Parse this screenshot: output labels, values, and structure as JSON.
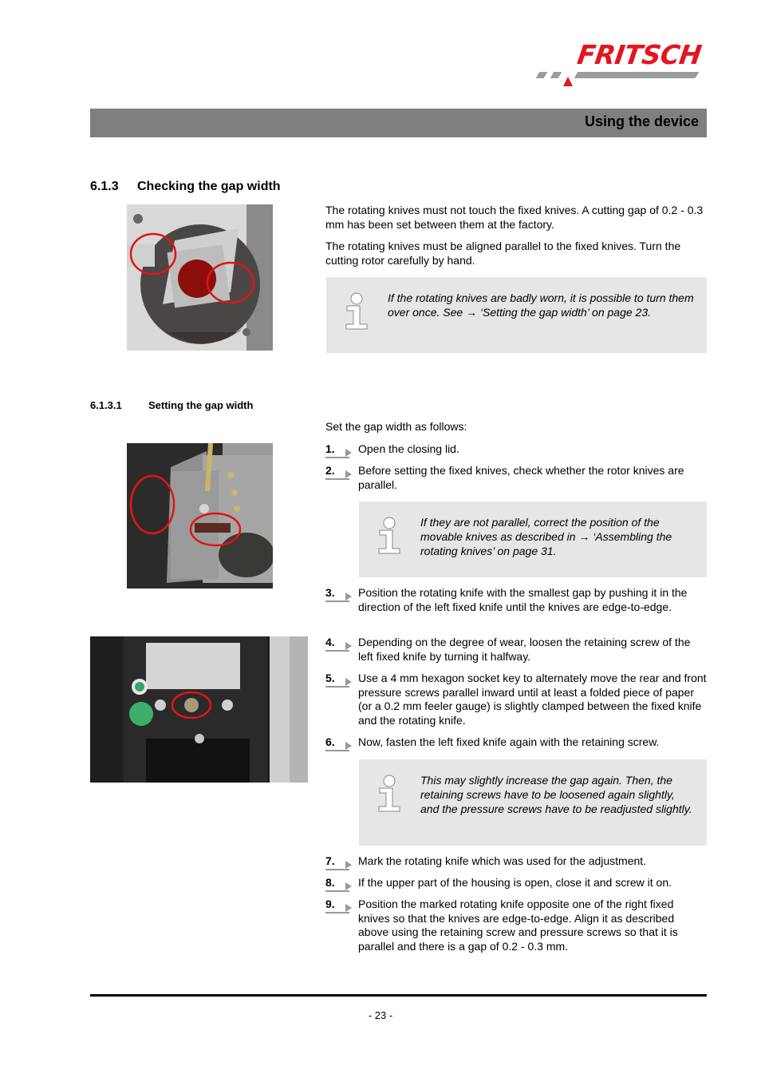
{
  "brand": {
    "logo_text": "FRITSCH",
    "accent": "#e3151e",
    "bar_gray": "#9c9c9c"
  },
  "header": {
    "title": "Using the device",
    "band_color": "#7f7f7f"
  },
  "section": {
    "number": "6.1.3",
    "title": "Checking the gap width",
    "paragraphs": [
      "The rotating knives must not touch the fixed knives. A cutting gap of 0.2 - 0.3 mm has been set between them at the factory.",
      "The rotating knives must be aligned parallel to the fixed knives. Turn the cutting rotor carefully by hand."
    ],
    "info": "If the rotating knives are badly worn, it is possible to turn them over once. See → ‘Setting the gap width’ on page 23.",
    "photo": "rotor-knives-photo"
  },
  "subsection": {
    "number": "6.1.3.1",
    "title": "Setting the gap width",
    "intro": "Set the gap width as follows:",
    "steps": [
      {
        "num": "1.",
        "text": "Open the closing lid."
      },
      {
        "num": "2.",
        "text": "Before setting the fixed knives, check whether the rotor knives are parallel."
      },
      {
        "num": "3.",
        "text": "Position the rotating knife with the smallest gap by pushing it in the direction of the left fixed knife until the knives are edge-to-edge."
      },
      {
        "num": "4.",
        "text": "Depending on the degree of wear, loosen the retaining screw of the left fixed knife by turning it halfway."
      },
      {
        "num": "5.",
        "text": "Use a 4 mm hexagon socket key to alternately move the rear and front pressure screws parallel inward until at least a folded piece of paper (or a 0.2 mm feeler gauge) is slightly clamped between the fixed knife and the rotating knife."
      },
      {
        "num": "6.",
        "text": "Now, fasten the left fixed knife again with the retaining screw."
      },
      {
        "num": "7.",
        "text": "Mark the rotating knife which was used for the adjustment."
      },
      {
        "num": "8.",
        "text": "If the upper part of the housing is open, close it and screw it on."
      },
      {
        "num": "9.",
        "text": "Position the marked rotating knife opposite one of the right fixed knives so that the knives are edge-to-edge. Align it as described above using the retaining screw and pressure screws so that it is parallel and there is a gap of 0.2 - 0.3 mm."
      }
    ],
    "info_after_step_2": "If they are not parallel, correct the position of the movable knives as described in → ‘Assembling the rotating knives’ on page 31.",
    "info_after_step_6": "This may slightly increase the gap again. Then, the retaining screws have to be loosened again slightly, and the pressure screws have to be readjusted slightly.",
    "photos": [
      "fixed-knife-photo",
      "retaining-screw-photo"
    ]
  },
  "footer": {
    "page_number": "- 23 -"
  }
}
